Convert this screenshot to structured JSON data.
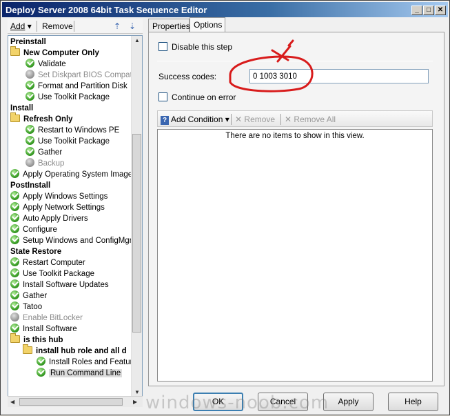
{
  "window": {
    "title": "Deploy Server 2008 64bit Task Sequence Editor"
  },
  "left_toolbar": {
    "add": "Add",
    "remove": "Remove"
  },
  "tree": [
    {
      "label": "Preinstall",
      "kind": "group"
    },
    {
      "label": "New Computer Only",
      "kind": "folder-group"
    },
    {
      "label": "Validate",
      "kind": "ok"
    },
    {
      "label": "Set Diskpart BIOS Compatibi",
      "kind": "disabled"
    },
    {
      "label": "Format and Partition Disk",
      "kind": "ok"
    },
    {
      "label": "Use Toolkit Package",
      "kind": "ok"
    },
    {
      "label": "Install",
      "kind": "group"
    },
    {
      "label": "Refresh Only",
      "kind": "folder-group"
    },
    {
      "label": "Restart to Windows PE",
      "kind": "ok"
    },
    {
      "label": "Use Toolkit Package",
      "kind": "ok"
    },
    {
      "label": "Gather",
      "kind": "ok"
    },
    {
      "label": "Backup",
      "kind": "disabled"
    },
    {
      "label": "Apply Operating System Image",
      "kind": "ok"
    },
    {
      "label": "PostInstall",
      "kind": "group"
    },
    {
      "label": "Apply Windows Settings",
      "kind": "ok"
    },
    {
      "label": "Apply Network Settings",
      "kind": "ok"
    },
    {
      "label": "Auto Apply Drivers",
      "kind": "ok"
    },
    {
      "label": "Configure",
      "kind": "ok"
    },
    {
      "label": "Setup Windows and ConfigMgr",
      "kind": "ok"
    },
    {
      "label": "State Restore",
      "kind": "group"
    },
    {
      "label": "Restart Computer",
      "kind": "ok"
    },
    {
      "label": "Use Toolkit Package",
      "kind": "ok"
    },
    {
      "label": "Install Software Updates",
      "kind": "ok"
    },
    {
      "label": "Gather",
      "kind": "ok"
    },
    {
      "label": "Tatoo",
      "kind": "ok"
    },
    {
      "label": "Enable BitLocker",
      "kind": "disabled"
    },
    {
      "label": "Install Software",
      "kind": "ok"
    },
    {
      "label": "is this hub",
      "kind": "folder-group"
    },
    {
      "label": "install hub role and all d",
      "kind": "folder-group"
    },
    {
      "label": "Install Roles and Feature",
      "kind": "ok"
    },
    {
      "label": "Run Command Line",
      "kind": "ok",
      "selected": true
    }
  ],
  "tabs": {
    "properties": "Properties",
    "options": "Options"
  },
  "options": {
    "disable_step": "Disable this step",
    "success_codes_label": "Success codes:",
    "success_codes_value": "0 1003 3010",
    "continue_on_error": "Continue on error"
  },
  "conditions": {
    "add_condition": "Add Condition",
    "remove": "Remove",
    "remove_all": "Remove All",
    "empty_text": "There are no items to show in this view."
  },
  "buttons": {
    "ok": "OK",
    "cancel": "Cancel",
    "apply": "Apply",
    "help": "Help"
  },
  "watermark": "windows-noob.com",
  "colors": {
    "annotation": "#d81b1b",
    "accent": "#3c7fb1"
  }
}
